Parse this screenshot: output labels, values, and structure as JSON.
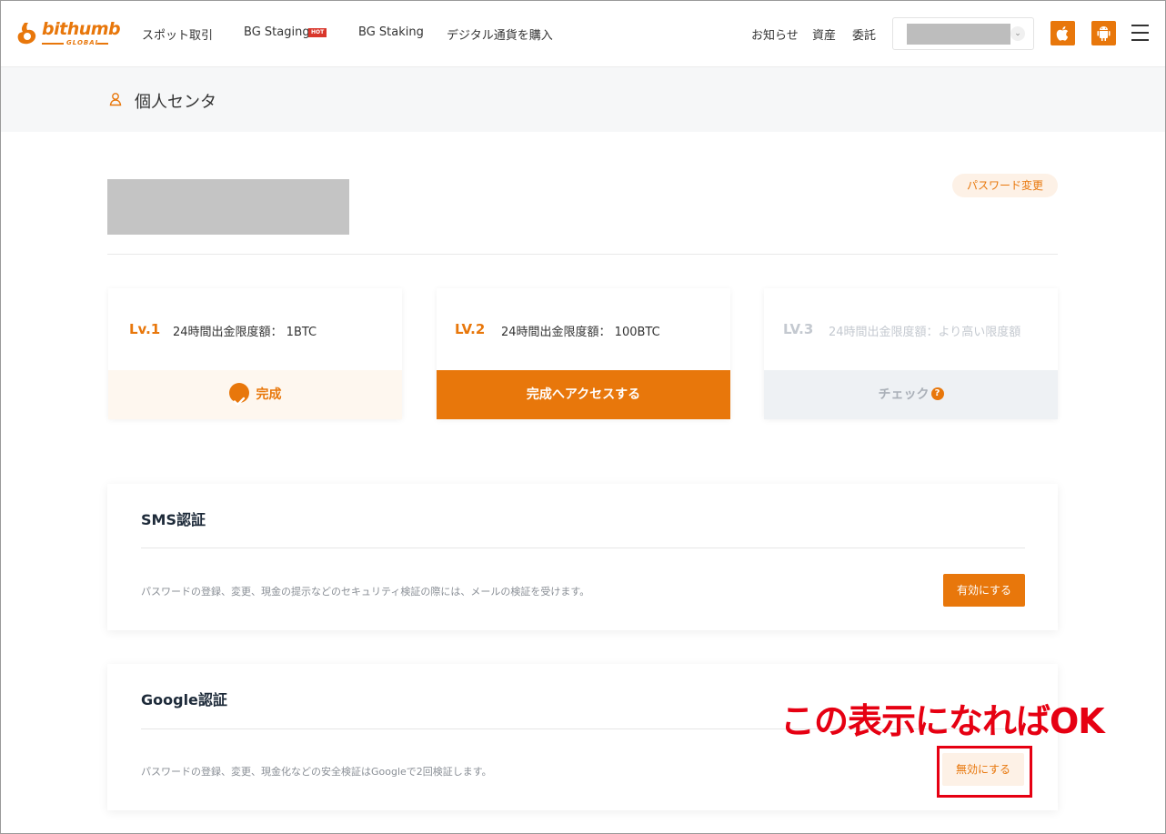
{
  "header": {
    "logo": {
      "word": "bithumb",
      "sub": "GLOBAL"
    },
    "nav": [
      {
        "label": "スポット取引"
      },
      {
        "label": "BG Staging",
        "badge": "HOT"
      },
      {
        "label": "BG Staking"
      },
      {
        "label": "デジタル通貨を購入"
      }
    ],
    "right_links": [
      "お知らせ",
      "資産",
      "委託"
    ],
    "icons": {
      "chevron": "chevron-down-icon",
      "ios": "apple-icon",
      "android": "android-icon",
      "menu": "hamburger-menu-icon"
    }
  },
  "banner": {
    "title": "個人センタ",
    "icon": "user-icon"
  },
  "profile": {
    "password_change_label": "パスワード変更"
  },
  "levels": [
    {
      "badge": "Lv.1",
      "text": "24時間出金限度額： 1BTC",
      "status": "完成"
    },
    {
      "badge": "LV.2",
      "text": "24時間出金限度額： 100BTC",
      "status": "完成へアクセスする"
    },
    {
      "badge": "LV.3",
      "text": "24時間出金限度額：より高い限度額",
      "status": "チェック",
      "help": "?"
    }
  ],
  "sms": {
    "title": "SMS認証",
    "description": "パスワードの登録、変更、現金の提示などのセキュリティ検証の際には、メールの検証を受けます。",
    "button": "有効にする"
  },
  "google": {
    "title": "Google認証",
    "description": "パスワードの登録、変更、現金化などの安全検証はGoogleで2回検証します。",
    "button": "無効にする"
  },
  "annotation": {
    "text": "この表示になればOK",
    "color": "#e60012"
  },
  "colors": {
    "accent": "#e8770b",
    "annotation_red": "#e60012"
  }
}
